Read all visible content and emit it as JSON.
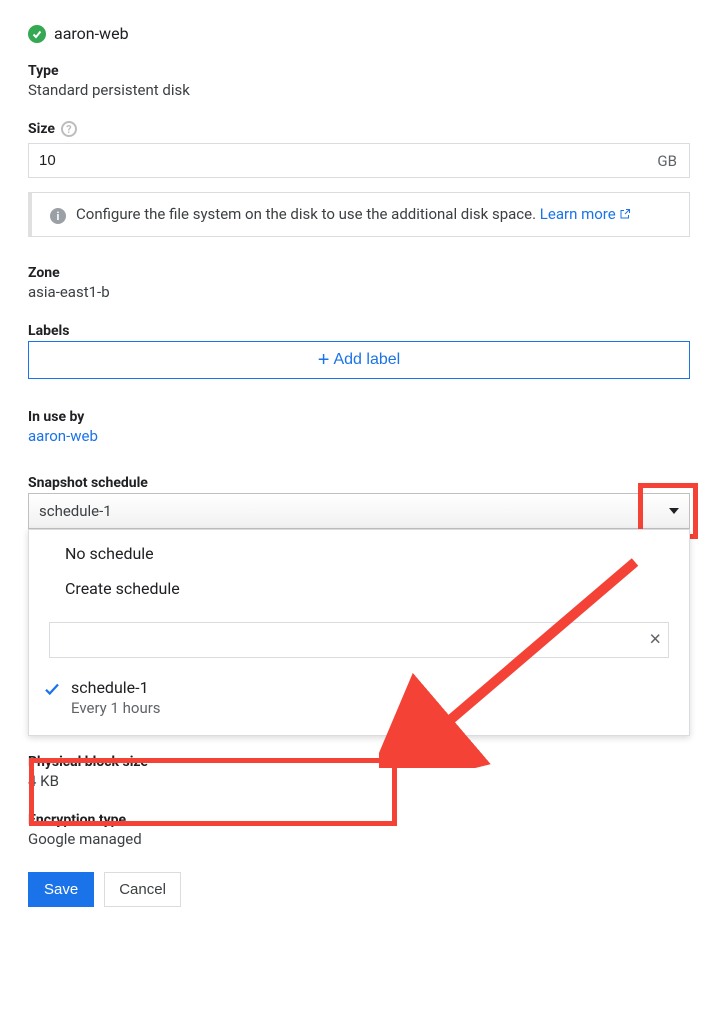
{
  "disk": {
    "name": "aaron-web"
  },
  "type": {
    "label": "Type",
    "value": "Standard persistent disk"
  },
  "size": {
    "label": "Size",
    "value": "10",
    "unit": "GB"
  },
  "info": {
    "text": "Configure the file system on the disk to use the additional disk space. ",
    "link": "Learn more"
  },
  "zone": {
    "label": "Zone",
    "value": "asia-east1-b"
  },
  "labels": {
    "label": "Labels",
    "add_button": "Add label"
  },
  "in_use": {
    "label": "In use by",
    "link": "aaron-web"
  },
  "schedule": {
    "label": "Snapshot schedule",
    "selected": "schedule-1",
    "options": [
      {
        "label": "No schedule"
      },
      {
        "label": "Create schedule"
      }
    ],
    "filter_value": "",
    "selected_item": {
      "name": "schedule-1",
      "sub": "Every 1 hours"
    }
  },
  "phys_block": {
    "label": "Physical block size",
    "value": "4 KB"
  },
  "encryption": {
    "label": "Encryption type",
    "value": "Google managed"
  },
  "buttons": {
    "save": "Save",
    "cancel": "Cancel"
  }
}
